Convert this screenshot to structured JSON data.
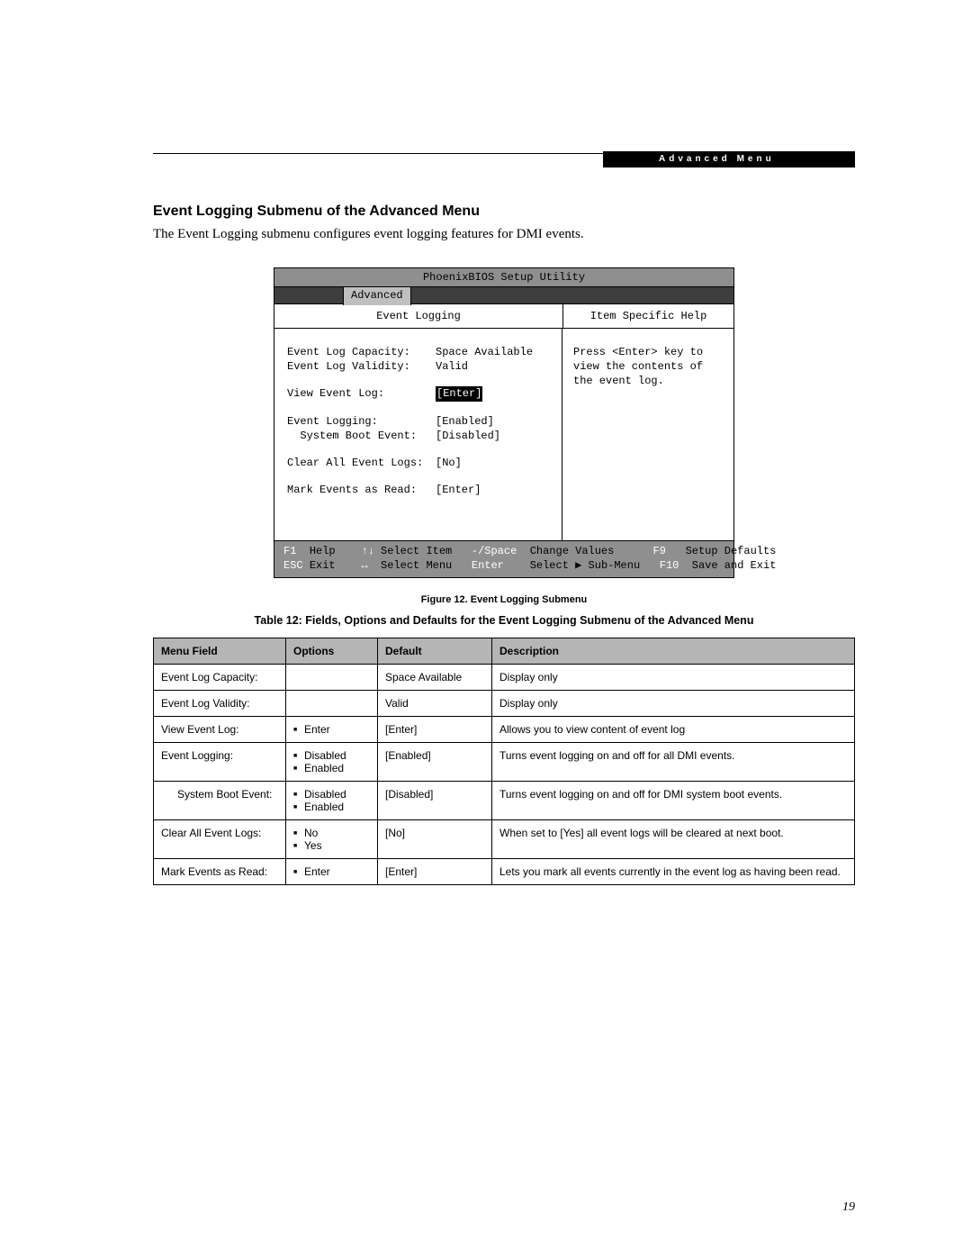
{
  "header_bar": "Advanced Menu",
  "section_title": "Event Logging Submenu of the Advanced Menu",
  "intro": "The Event Logging submenu configures event logging features for DMI events.",
  "bios": {
    "title": "PhoenixBIOS Setup Utility",
    "tab": "Advanced",
    "left_heading": "Event Logging",
    "right_heading": "Item Specific Help",
    "help_text": "Press <Enter> key to view the contents of the event log.",
    "rows": [
      {
        "label": "Event Log Capacity:",
        "value": "Space Available",
        "sel": false
      },
      {
        "label": "Event Log Validity:",
        "value": "Valid",
        "sel": false
      },
      {
        "spacer": true
      },
      {
        "label": "View Event Log:",
        "value": "[Enter]",
        "sel": true
      },
      {
        "spacer": true
      },
      {
        "label": "Event Logging:",
        "value": "[Enabled]",
        "sel": false
      },
      {
        "label": "  System Boot Event:",
        "value": "[Disabled]",
        "sel": false
      },
      {
        "spacer": true
      },
      {
        "label": "Clear All Event Logs:",
        "value": "[No]",
        "sel": false
      },
      {
        "spacer": true
      },
      {
        "label": "Mark Events as Read:",
        "value": "[Enter]",
        "sel": false
      }
    ],
    "footer": {
      "r1": {
        "k1": "F1",
        "t1": "Help",
        "k2": "↑↓",
        "t2": "Select Item",
        "k3": "-/Space",
        "t3": "Change Values",
        "k4": "F9",
        "t4": "Setup Defaults"
      },
      "r2": {
        "k1": "ESC",
        "t1": "Exit",
        "k2": "↔",
        "t2": "Select Menu",
        "k3": "Enter",
        "t3": "Select ▶ Sub-Menu",
        "k4": "F10",
        "t4": "Save and Exit"
      }
    }
  },
  "figure_caption": "Figure 12.  Event Logging Submenu",
  "table_caption": "Table 12: Fields, Options and Defaults for the Event Logging Submenu of the Advanced Menu",
  "table": {
    "headers": {
      "c1": "Menu Field",
      "c2": "Options",
      "c3": "Default",
      "c4": "Description"
    },
    "rows": [
      {
        "field": "Event Log Capacity:",
        "indent": false,
        "options": [],
        "default": "Space Available",
        "desc": "Display only"
      },
      {
        "field": "Event Log Validity:",
        "indent": false,
        "options": [],
        "default": "Valid",
        "desc": "Display only"
      },
      {
        "field": "View Event Log:",
        "indent": false,
        "options": [
          "Enter"
        ],
        "default": "[Enter]",
        "desc": "Allows you to view content of event log"
      },
      {
        "field": "Event Logging:",
        "indent": false,
        "options": [
          "Disabled",
          "Enabled"
        ],
        "default": "[Enabled]",
        "desc": "Turns event logging on and off for all DMI events."
      },
      {
        "field": "System Boot Event:",
        "indent": true,
        "options": [
          "Disabled",
          "Enabled"
        ],
        "default": "[Disabled]",
        "desc": "Turns event logging on and off for DMI system boot events."
      },
      {
        "field": "Clear All Event Logs:",
        "indent": false,
        "options": [
          "No",
          "Yes"
        ],
        "default": "[No]",
        "desc": "When set to [Yes] all event logs will be cleared at next boot."
      },
      {
        "field": "Mark Events as Read:",
        "indent": false,
        "options": [
          "Enter"
        ],
        "default": "[Enter]",
        "desc": "Lets you mark all events currently in the event log as having been read."
      }
    ]
  },
  "page_number": "19"
}
